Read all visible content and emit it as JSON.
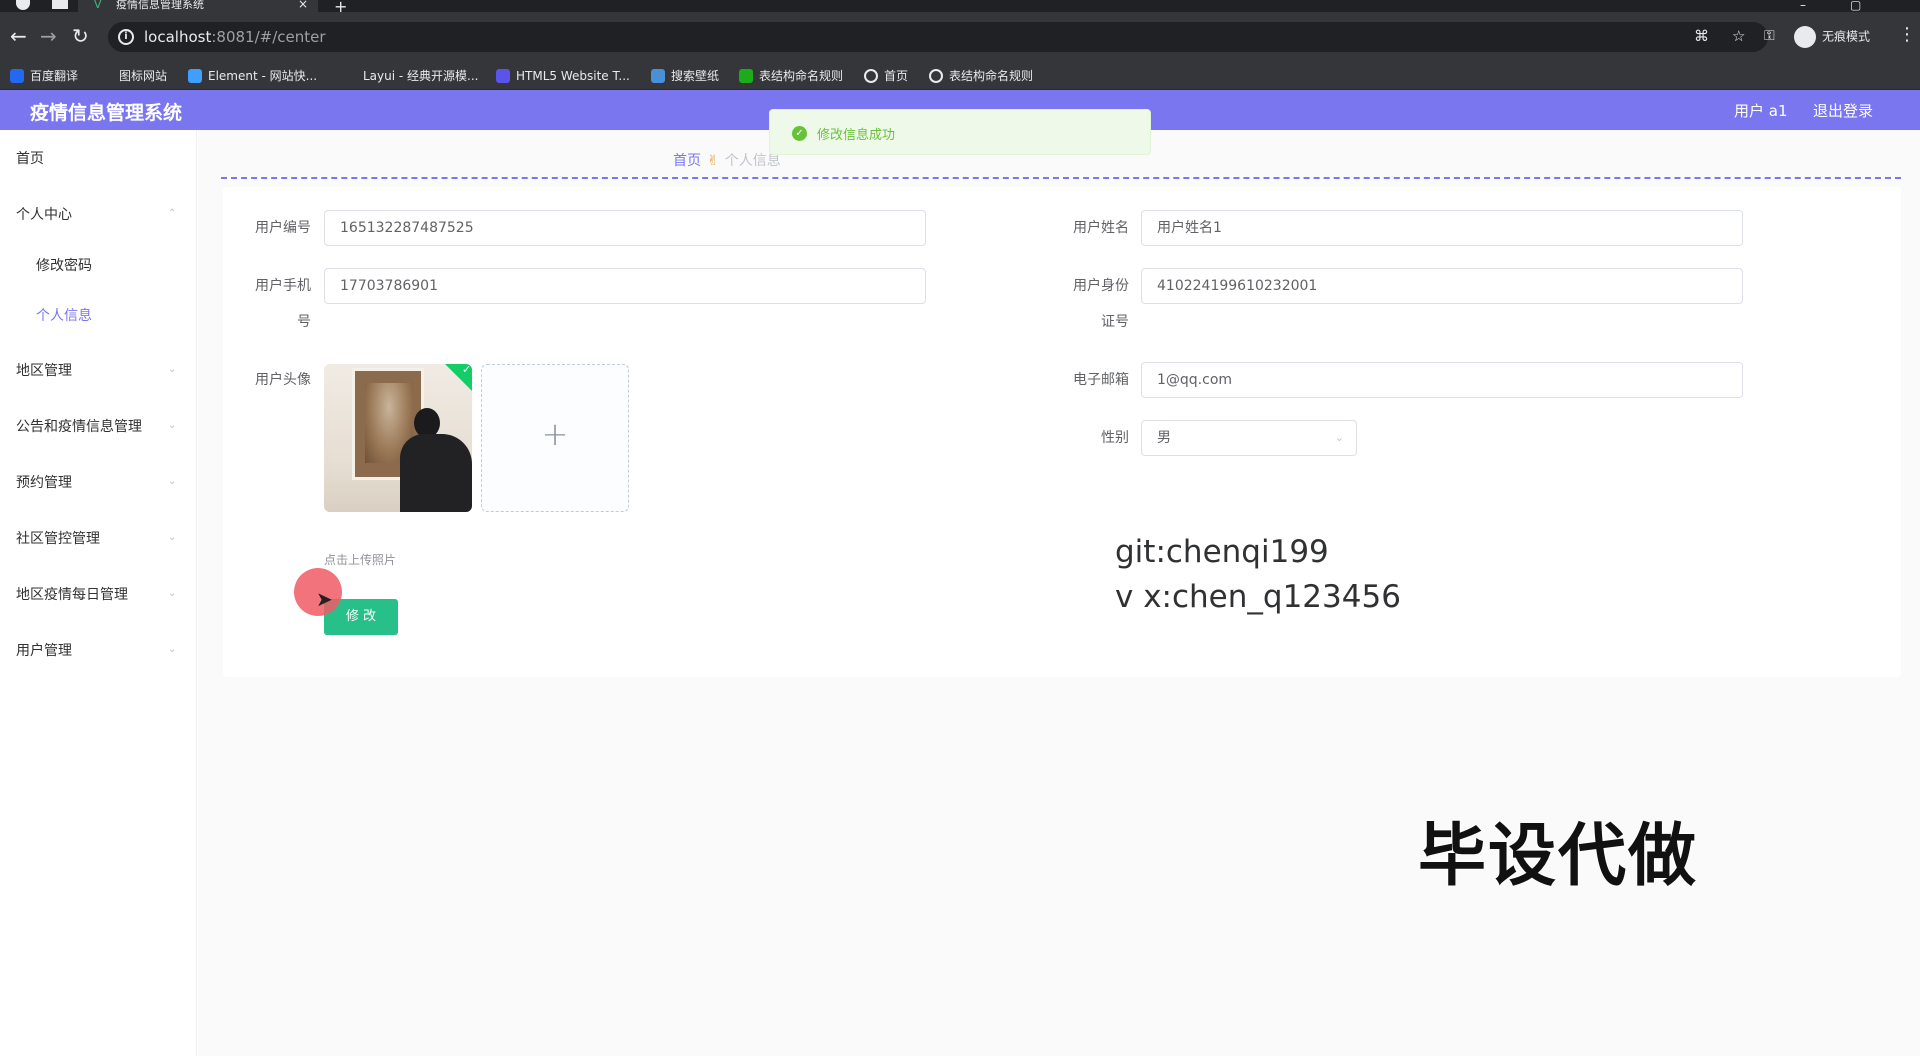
{
  "browser": {
    "tab_title": "疫情信息管理系统",
    "url_host": "localhost",
    "url_rest": ":8081/#/center",
    "incognito_label": "无痕模式",
    "bookmarks": [
      {
        "label": "百度翻译",
        "icon": "translate-icon",
        "color": "#2468f2"
      },
      {
        "label": "图标网站",
        "icon": "flag-icon",
        "color": "#35363a"
      },
      {
        "label": "Element - 网站快...",
        "icon": "element-icon",
        "color": "#409eff"
      },
      {
        "label": "Layui - 经典开源模...",
        "icon": "layui-icon",
        "color": "#35363a"
      },
      {
        "label": "HTML5 Website T...",
        "icon": "html5-icon",
        "color": "#5b54e8"
      },
      {
        "label": "搜索壁纸",
        "icon": "wallpaper-icon",
        "color": "#4a90d9"
      },
      {
        "label": "表结构命名规则",
        "icon": "sheet-icon",
        "color": "#1aad19"
      },
      {
        "label": "首页",
        "icon": "globe-icon",
        "color": "#35363a"
      },
      {
        "label": "表结构命名规则",
        "icon": "globe-icon",
        "color": "#35363a"
      }
    ]
  },
  "header": {
    "title": "疫情信息管理系统",
    "user": "用户 a1",
    "logout": "退出登录"
  },
  "toast": {
    "message": "修改信息成功"
  },
  "sidebar": {
    "items": [
      {
        "label": "首页",
        "name": "sidebar-item-home"
      },
      {
        "label": "个人中心",
        "name": "sidebar-item-personal-center"
      },
      {
        "label": "修改密码",
        "name": "sidebar-item-change-password"
      },
      {
        "label": "个人信息",
        "name": "sidebar-item-personal-info"
      },
      {
        "label": "地区管理",
        "name": "sidebar-item-region"
      },
      {
        "label": "公告和疫情信息管理",
        "name": "sidebar-item-notice"
      },
      {
        "label": "预约管理",
        "name": "sidebar-item-appointment"
      },
      {
        "label": "社区管控管理",
        "name": "sidebar-item-community"
      },
      {
        "label": "地区疫情每日管理",
        "name": "sidebar-item-daily"
      },
      {
        "label": "用户管理",
        "name": "sidebar-item-users"
      }
    ]
  },
  "breadcrumb": {
    "home": "首页",
    "current": "个人信息"
  },
  "form": {
    "user_id_label": "用户编号",
    "user_id_value": "165132287487525",
    "user_name_label": "用户姓名",
    "user_name_value": "用户姓名1",
    "phone_label_1": "用户手机",
    "phone_label_2": "号",
    "phone_value": "17703786901",
    "idcard_label_1": "用户身份",
    "idcard_label_2": "证号",
    "idcard_value": "410224199610232001",
    "avatar_label": "用户头像",
    "email_label": "电子邮箱",
    "email_value": "1@qq.com",
    "gender_label": "性别",
    "gender_value": "男",
    "upload_tip": "点击上传照片",
    "submit_label": "修 改"
  },
  "overlay": {
    "git": "git:chenqi199",
    "wechat": "v x:chen_q123456",
    "watermark": "毕设代做"
  },
  "colors": {
    "accent": "#7a76f0",
    "success": "#67c23a",
    "button": "#27c08a"
  }
}
